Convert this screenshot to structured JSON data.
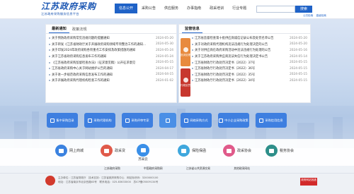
{
  "header": {
    "logo_title": "江苏政府采购",
    "logo_subtitle": "江苏政府采购服务信息平台",
    "nav": [
      "信息公开",
      "采购公告",
      "供应服务",
      "办事指南",
      "政采培训",
      "行业专题"
    ],
    "search_button": "搜索",
    "links": [
      "公共检索",
      "高级检索"
    ]
  },
  "left_panel": {
    "tabs": [
      "最新通知",
      "政策法规"
    ],
    "rows": [
      {
        "title": "关于预防政府采购常见违规问题的提醒通知",
        "date": "2024-05-20"
      },
      {
        "title": "关于转发《江苏省财政厅关于开展政府采购领域专项整治工作的通知》的通知",
        "date": "2024-05-30"
      },
      {
        "title": "关于印发2024年政府采购各项重点工作安排及政策措施的通知",
        "date": "2024-05-24"
      },
      {
        "title": "关于江苏省政府采购信息发布工作的通知",
        "date": "2024-05-24"
      },
      {
        "title": "《江苏省政府采购监督检查办法》（征求意见稿）公开征求意见",
        "date": "2024-05-15"
      },
      {
        "title": "江苏省政府采购中心关于网站维护公告的通知",
        "date": "2024-04-17"
      },
      {
        "title": "关于进一步规范政府采购信息发布工作的通知",
        "date": "2024-04-15"
      },
      {
        "title": "关于开展政府采购代理机构检查工作的通知",
        "date": "2024-01-02"
      }
    ]
  },
  "right_panel": {
    "tabs": [
      "监管信息"
    ],
    "side": [
      "投诉处理",
      "行政处罚"
    ],
    "rows": [
      {
        "title": "江苏省监督检查第十批供应商诚信记录公布及处罚名单公告",
        "date": "2024-05-20"
      },
      {
        "title": "关于对政府采购代理机构违法违规行为处理决定的公告",
        "date": "2024-05-20"
      },
      {
        "title": "关于对供应商在政府采购活动中违法违规行为处理的公告",
        "date": "2024-05-16"
      },
      {
        "title": "关于江苏政府采购供应商违法失信行为处理决定书公告",
        "date": "2024-05-14"
      },
      {
        "title": "江苏省财政厅行政处罚决定书（2022）37号",
        "date": "2024-05-15"
      },
      {
        "title": "江苏省财政厅行政处罚决定书（2022）36号",
        "date": "2024-05-15"
      },
      {
        "title": "江苏省财政厅行政处罚决定书（2022）35号",
        "date": "2024-05-15"
      },
      {
        "title": "江苏省财政厅行政处罚决定书（2022）34号",
        "date": "2024-05-15"
      }
    ]
  },
  "services": [
    "集中采购目录",
    "采购代理机构",
    "采购评审专家",
    "评审专家",
    "网络采购方式",
    "中小企业采购政策",
    "采购信用信息"
  ],
  "apps": [
    "网上商城",
    "政采贷",
    "苏采云",
    "保险保函",
    "政采协会",
    "税务协会"
  ],
  "links_row": [
    "江苏政府采购",
    "中国政府采购网",
    "江苏省公共资源交易",
    "其他政采网站"
  ],
  "footer": {
    "line1": "主办单位：江苏省财政厅　技术支持：江苏省政府采购中心　网站标识码：3200000100",
    "line2": "地址：江苏省南京市北京西路63号　联系电话：025-83633000　苏ICP备05009134号",
    "badge": "政府网站找错"
  },
  "colors": {
    "primary": "#1f62c7",
    "accent_orange": "#e88a3e",
    "accent_red": "#c7372e"
  }
}
